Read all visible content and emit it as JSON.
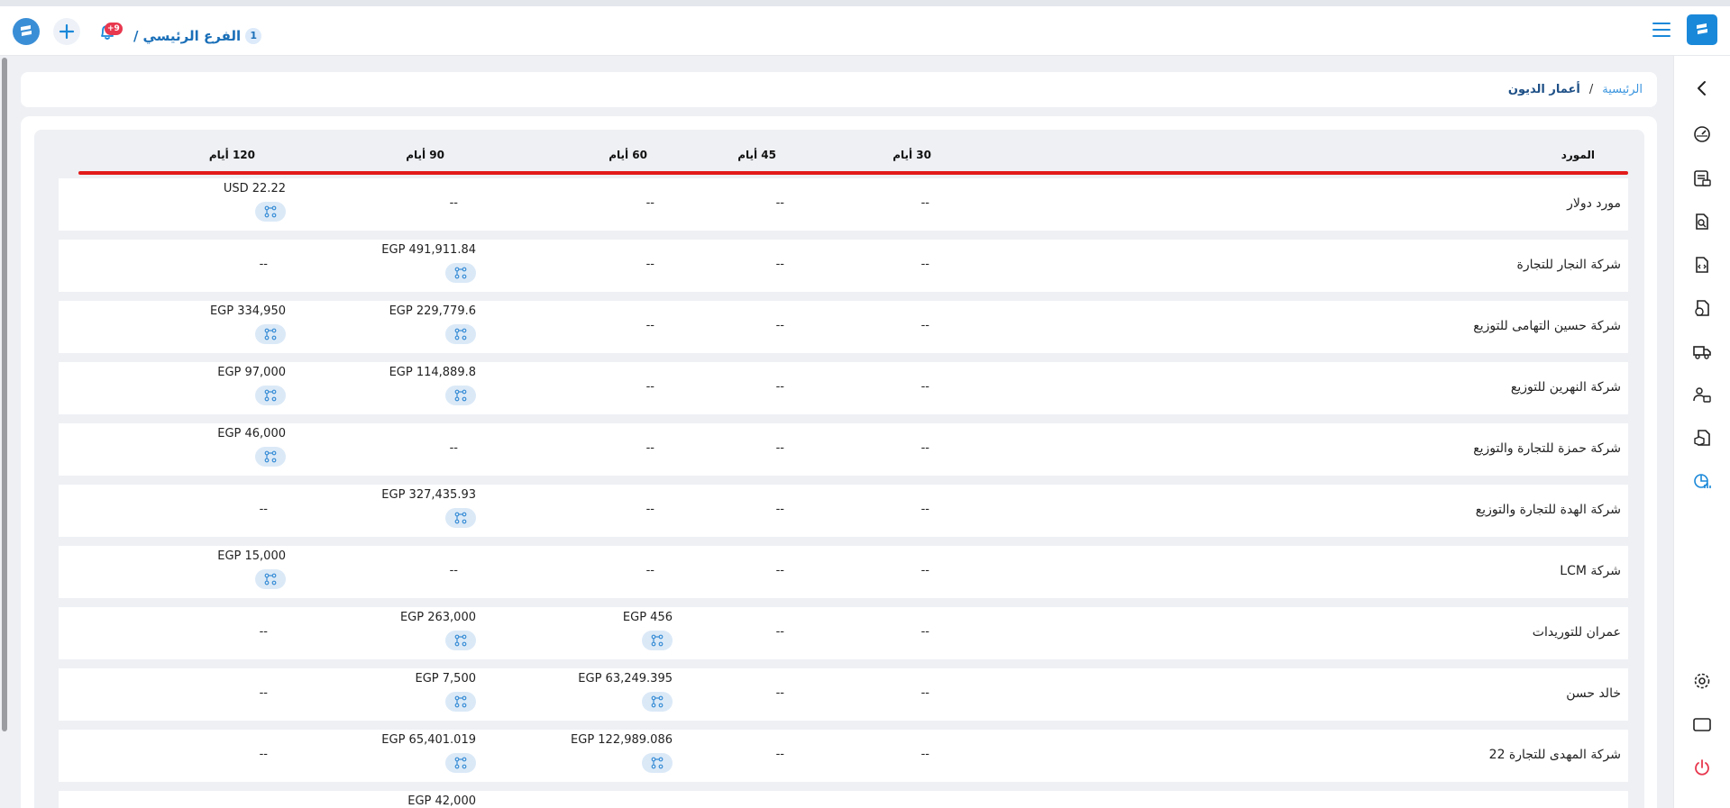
{
  "header": {
    "branch_number": "1",
    "branch_name": "الفرع الرئيسي",
    "branch_separator": "/",
    "notification_count": "+9"
  },
  "breadcrumb": {
    "home": "الرئيسية",
    "separator": "/",
    "current": "أعمار الديون"
  },
  "table": {
    "columns": {
      "supplier": "المورد",
      "d30": "30 أيام",
      "d45": "45 أيام",
      "d60": "60 أيام",
      "d90": "90 أيام",
      "d120": "120 أيام"
    },
    "empty": "--",
    "rows": [
      {
        "name": "مورد دولار",
        "d30": "--",
        "d45": "--",
        "d60": "--",
        "d90": "--",
        "d120": "USD 22.22"
      },
      {
        "name": "شركة النجار للتجارة",
        "d30": "--",
        "d45": "--",
        "d60": "--",
        "d90": "EGP 491,911.84",
        "d120": "--"
      },
      {
        "name": "شركة حسين التهامى للتوزيع",
        "d30": "--",
        "d45": "--",
        "d60": "--",
        "d90": "EGP 229,779.6",
        "d120": "EGP 334,950"
      },
      {
        "name": "شركة النهرين للتوزيع",
        "d30": "--",
        "d45": "--",
        "d60": "--",
        "d90": "EGP 114,889.8",
        "d120": "EGP 97,000"
      },
      {
        "name": "شركة حمزة للتجارة والتوزيع",
        "d30": "--",
        "d45": "--",
        "d60": "--",
        "d90": "--",
        "d120": "EGP 46,000"
      },
      {
        "name": "شركة الهدة للتجارة والتوزيع",
        "d30": "--",
        "d45": "--",
        "d60": "--",
        "d90": "EGP 327,435.93",
        "d120": "--"
      },
      {
        "name": "شركة LCM",
        "d30": "--",
        "d45": "--",
        "d60": "--",
        "d90": "--",
        "d120": "EGP 15,000"
      },
      {
        "name": "عمران للتوريدات",
        "d30": "--",
        "d45": "--",
        "d60": "EGP 456",
        "d90": "EGP 263,000",
        "d120": "--"
      },
      {
        "name": "خالد حسن",
        "d30": "--",
        "d45": "--",
        "d60": "EGP 63,249.395",
        "d90": "EGP 7,500",
        "d120": "--"
      },
      {
        "name": "شركة المهدى للتجارة 22",
        "d30": "--",
        "d45": "--",
        "d60": "EGP 122,989.086",
        "d90": "EGP 65,401.019",
        "d120": "--"
      },
      {
        "name": "",
        "d30": "",
        "d45": "",
        "d60": "",
        "d90": "EGP 42,000",
        "d120": ""
      }
    ]
  },
  "icons": {
    "sidebar": [
      "chevron-left-icon",
      "gauge-icon",
      "invoice-list-icon",
      "document-search-icon",
      "document-code-icon",
      "document-user-icon",
      "delivery-truck-icon",
      "users-settings-icon",
      "cube-document-icon",
      "report-chart-icon",
      "settings-icon",
      "window-icon",
      "power-icon"
    ],
    "accent": "#1a88d9",
    "danger": "#e8384f"
  }
}
